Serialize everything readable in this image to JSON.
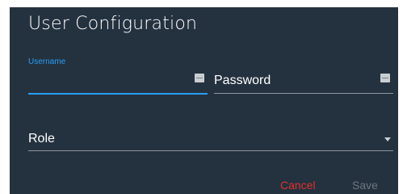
{
  "dialog": {
    "title": "User Configuration"
  },
  "form": {
    "username": {
      "label": "Username",
      "value": ""
    },
    "password": {
      "label": "Password",
      "value": ""
    },
    "role": {
      "label": "Role",
      "value": ""
    }
  },
  "actions": {
    "cancel_label": "Cancel",
    "save_label": "Save"
  },
  "colors": {
    "background": "#243240",
    "accent": "#2a9df4",
    "cancel": "#e0302a",
    "disabled": "#6d767e"
  },
  "icons": {
    "username_field": "keyboard-icon",
    "password_field": "keyboard-icon",
    "role_field": "dropdown-arrow-icon"
  }
}
